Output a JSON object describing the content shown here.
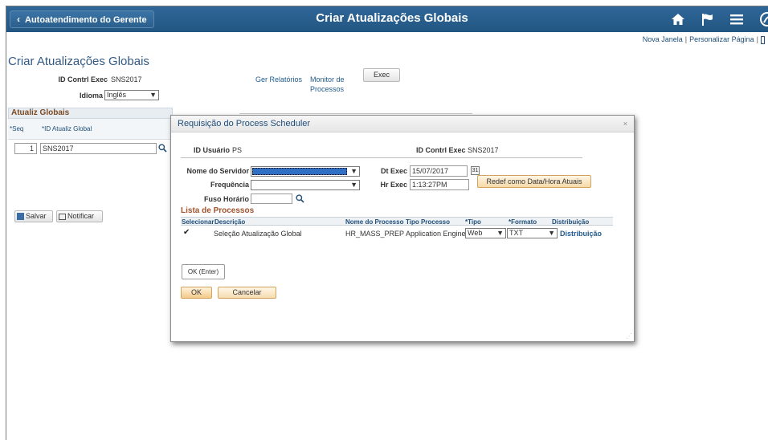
{
  "header": {
    "back_label": "Autoatendimento do Gerente",
    "title": "Criar Atualizações Globais",
    "icons": [
      "home-icon",
      "flag-icon",
      "menu-icon",
      "compass-icon"
    ]
  },
  "toplinks": {
    "new_window": "Nova Janela",
    "personalize": "Personalizar Página"
  },
  "page": {
    "title": "Criar Atualizações Globais",
    "run_control_label": "ID Contrl Exec",
    "run_control_value": "SNS2017",
    "language_label": "Idioma",
    "language_value": "Inglês",
    "report_manager": "Ger Relatórios",
    "process_monitor_line1": "Monitor de",
    "process_monitor_line2": "Processos",
    "exec_button": "Exec"
  },
  "grid": {
    "title": "Atualiz Globais",
    "col_seq": "*Seq",
    "col_id": "*ID Atualiz Global",
    "row_seq": "1",
    "row_id": "SNS2017"
  },
  "actions": {
    "save": "Salvar",
    "notify": "Notificar"
  },
  "dialog": {
    "title": "Requisição do Process Scheduler",
    "close": "×",
    "user_id_label": "ID Usuário",
    "user_id_value": "PS",
    "run_control_label": "ID Contrl Exec",
    "run_control_value": "SNS2017",
    "server_label": "Nome do Servidor",
    "server_value": "",
    "frequency_label": "Frequência",
    "frequency_value": "",
    "timezone_label": "Fuso Horário",
    "timezone_value": "",
    "run_date_label": "Dt Exec",
    "run_date_value": "15/07/2017",
    "run_time_label": "Hr Exec",
    "run_time_value": "1:13:27PM",
    "reset_button": "Redef como Data/Hora Atuais",
    "process_list_title": "Lista de Processos",
    "columns": {
      "select": "Selecionar",
      "description": "Descrição",
      "process_name": "Nome do Processo",
      "process_type": "Tipo Processo",
      "type": "*Tipo",
      "format": "*Formato",
      "distribution": "Distribuição"
    },
    "row": {
      "selected": "✔",
      "description": "Seleção Atualização Global",
      "process_name": "HR_MASS_PREP",
      "process_type": "Application Engine",
      "type": "Web",
      "format": "TXT",
      "distribution": "Distribuição"
    },
    "ok_enter": "OK (Enter)",
    "ok": "OK",
    "cancel": "Cancelar"
  }
}
